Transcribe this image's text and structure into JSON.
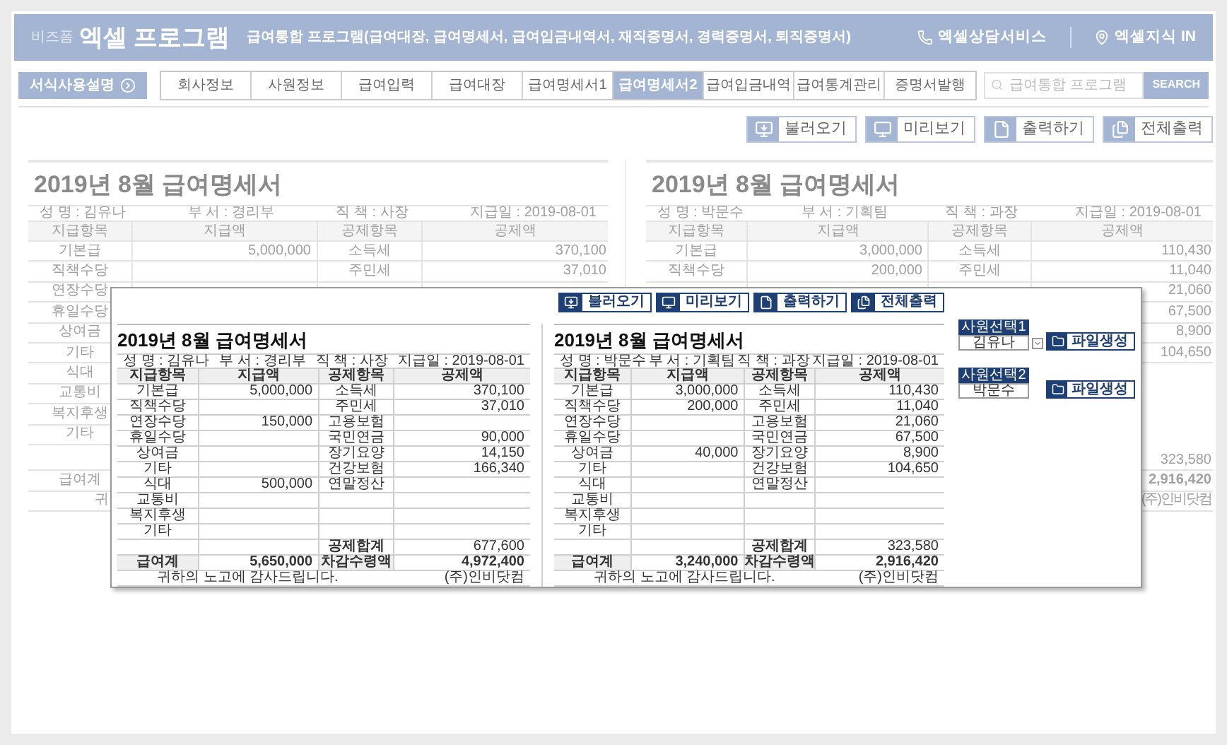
{
  "header": {
    "brand": "비즈폼",
    "title": "엑셀 프로그램",
    "subtitle": "급여통합 프로그램(급여대장, 급여명세서, 급여입금내역서, 재직증명서, 경력증명서, 퇴직증명서)",
    "links": [
      {
        "label": "엑셀상담서비스",
        "kind": "phone"
      },
      {
        "label": "엑셀지식 IN",
        "kind": "pin"
      }
    ]
  },
  "guide_button": "서식사용설명",
  "tabs": [
    {
      "label": "회사정보",
      "selected": false
    },
    {
      "label": "사원정보",
      "selected": false
    },
    {
      "label": "급여입력",
      "selected": false
    },
    {
      "label": "급여대장",
      "selected": false
    },
    {
      "label": "급여명세서1",
      "selected": false
    },
    {
      "label": "급여명세서2",
      "selected": true
    },
    {
      "label": "급여입금내역",
      "selected": false
    },
    {
      "label": "급여통계관리",
      "selected": false
    },
    {
      "label": "증명서발행",
      "selected": false
    }
  ],
  "search": {
    "placeholder": "급여통합 프로그램",
    "button": "SEARCH"
  },
  "toolbar": [
    {
      "label": "불러오기",
      "kind": "load"
    },
    {
      "label": "미리보기",
      "kind": "preview"
    },
    {
      "label": "출력하기",
      "kind": "print"
    },
    {
      "label": "전체출력",
      "kind": "print_all"
    }
  ],
  "background_slips": [
    {
      "title": "2019년 8월 급여명세서",
      "info": [
        "성 명 : 김유나",
        "부 서 : 경리부",
        "직 책 : 사장",
        "지급일 : 2019-08-01"
      ],
      "columns": [
        "지급항목",
        "지급액",
        "공제항목",
        "공제액"
      ],
      "rows": [
        {
          "item": "기본급",
          "pay": "5,000,000",
          "deduction": "소득세",
          "amount": "370,100"
        },
        {
          "item": "직책수당",
          "deduction": "주민세",
          "amount": "37,010"
        },
        {
          "item": "연장수당"
        },
        {
          "item": "휴일수당"
        },
        {
          "item": "상여금"
        },
        {
          "item": "기타"
        },
        {
          "item": "식대"
        },
        {
          "item": "교통비"
        },
        {
          "item": "복지후생"
        },
        {
          "item": "기타"
        }
      ],
      "total": {
        "item": "급여계"
      },
      "footer": {
        "note": "귀"
      }
    },
    {
      "title": "2019년 8월 급여명세서",
      "info": [
        "성 명 : 박문수",
        "부 서 : 기획팀",
        "직 책 : 과장",
        "지급일 : 2019-08-01"
      ],
      "columns": [
        "지급항목",
        "지급액",
        "공제항목",
        "공제액"
      ],
      "rows": [
        {
          "item": "기본급",
          "pay": "3,000,000",
          "deduction": "소득세",
          "amount": "110,430"
        },
        {
          "item": "직책수당",
          "pay": "200,000",
          "deduction": "주민세",
          "amount": "11,040"
        },
        {
          "amount": "21,060"
        },
        {
          "amount": "67,500"
        },
        {
          "amount": "8,900"
        },
        {
          "amount": "104,650"
        }
      ],
      "subtotal": {
        "amount": "323,580"
      },
      "total": {
        "amount": "2,916,420"
      },
      "footer": {
        "company": "(주)인비닷컴"
      }
    }
  ],
  "popup": {
    "toolbar": [
      {
        "label": "불러오기",
        "kind": "load"
      },
      {
        "label": "미리보기",
        "kind": "preview"
      },
      {
        "label": "출력하기",
        "kind": "print"
      },
      {
        "label": "전체출력",
        "kind": "print_all"
      }
    ],
    "slips": [
      {
        "title": "2019년 8월 급여명세서",
        "info": [
          "성 명 : 김유나",
          "부 서 : 경리부",
          "직 책 : 사장",
          "지급일 : 2019-08-01"
        ],
        "columns": [
          "지급항목",
          "지급액",
          "공제항목",
          "공제액"
        ],
        "rows": [
          {
            "item": "기본급",
            "pay": "5,000,000",
            "deduction": "소득세",
            "amount": "370,100"
          },
          {
            "item": "직책수당",
            "deduction": "주민세",
            "amount": "37,010"
          },
          {
            "item": "연장수당",
            "pay": "150,000",
            "deduction": "고용보험"
          },
          {
            "item": "휴일수당",
            "deduction": "국민연금",
            "amount": "90,000"
          },
          {
            "item": "상여금",
            "deduction": "장기요양",
            "amount": "14,150"
          },
          {
            "item": "기타",
            "deduction": "건강보험",
            "amount": "166,340"
          },
          {
            "item": "식대",
            "pay": "500,000",
            "deduction": "연말정산"
          },
          {
            "item": "교통비"
          },
          {
            "item": "복지후생"
          },
          {
            "item": "기타"
          }
        ],
        "subtotal": {
          "deduction": "공제합계",
          "amount": "677,600"
        },
        "total": {
          "item": "급여계",
          "pay": "5,650,000",
          "deduction": "차감수령액",
          "amount": "4,972,400"
        },
        "footer": {
          "note": "귀하의 노고에 감사드립니다.",
          "company": "(주)인비닷컴"
        }
      },
      {
        "title": "2019년 8월 급여명세서",
        "info": [
          "성 명 : 박문수",
          "부 서 : 기획팀",
          "직 책 : 과장",
          "지급일 : 2019-08-01"
        ],
        "columns": [
          "지급항목",
          "지급액",
          "공제항목",
          "공제액"
        ],
        "rows": [
          {
            "item": "기본급",
            "pay": "3,000,000",
            "deduction": "소득세",
            "amount": "110,430"
          },
          {
            "item": "직책수당",
            "pay": "200,000",
            "deduction": "주민세",
            "amount": "11,040"
          },
          {
            "item": "연장수당",
            "deduction": "고용보험",
            "amount": "21,060"
          },
          {
            "item": "휴일수당",
            "deduction": "국민연금",
            "amount": "67,500"
          },
          {
            "item": "상여금",
            "pay": "40,000",
            "deduction": "장기요양",
            "amount": "8,900"
          },
          {
            "item": "기타",
            "deduction": "건강보험",
            "amount": "104,650"
          },
          {
            "item": "식대",
            "deduction": "연말정산"
          },
          {
            "item": "교통비"
          },
          {
            "item": "복지후생"
          },
          {
            "item": "기타"
          }
        ],
        "subtotal": {
          "deduction": "공제합계",
          "amount": "323,580"
        },
        "total": {
          "item": "급여계",
          "pay": "3,240,000",
          "deduction": "차감수령액",
          "amount": "2,916,420"
        },
        "footer": {
          "note": "귀하의 노고에 감사드립니다.",
          "company": "(주)인비닷컴"
        }
      }
    ],
    "selectors": [
      {
        "label": "사원선택1",
        "value": "김유나",
        "dropdown": true,
        "button": "파일생성"
      },
      {
        "label": "사원선택2",
        "value": "박문수",
        "dropdown": false,
        "button": "파일생성"
      }
    ]
  }
}
